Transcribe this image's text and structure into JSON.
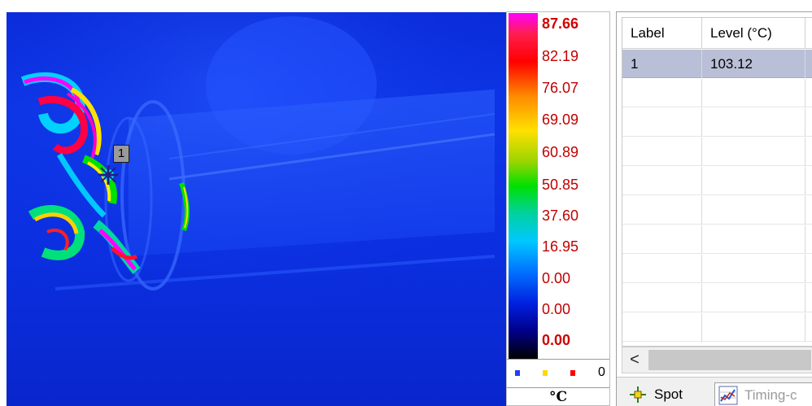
{
  "thermal_view": {
    "spot_label": "1"
  },
  "scale": {
    "values": [
      "87.66",
      "82.19",
      "76.07",
      "69.09",
      "60.89",
      "50.85",
      "37.60",
      "16.95",
      "0.00",
      "0.00",
      "0.00"
    ],
    "indicator_count": "0",
    "unit": "°C",
    "indicator_colors": [
      "#1f3fff",
      "#ffd800",
      "#ff0000"
    ],
    "gradient_colors": [
      "#ff00ff",
      "#ff0000",
      "#ff8a00",
      "#ffe000",
      "#00e000",
      "#00c8ff",
      "#0020e0",
      "#000000"
    ]
  },
  "table": {
    "headers": {
      "label": "Label",
      "level": "Level (°C)"
    },
    "rows": [
      {
        "label": "1",
        "level": "103.12"
      }
    ],
    "empty_row_count": 9,
    "selected_row_color": "#b9bfd6"
  },
  "scrollbar": {
    "left_arrow": "<"
  },
  "tabs": {
    "spot": {
      "label": "Spot",
      "icon": "crosshair-icon"
    },
    "timing": {
      "label": "Timing-c",
      "icon": "chart-icon"
    }
  }
}
